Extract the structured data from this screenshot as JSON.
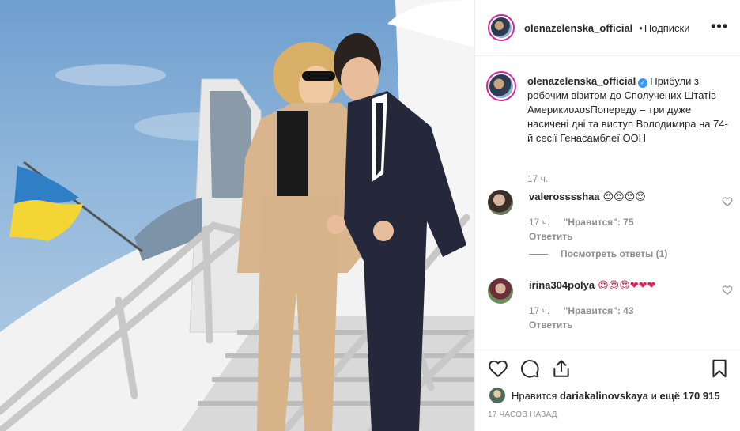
{
  "post": {
    "username": "olenazelenska_official",
    "dot": "•",
    "follow_label": "Подписки",
    "more_label": "•••"
  },
  "caption": {
    "username": "olenazelenska_official",
    "text": "Прибули з робочим візитом до Сполучених Штатів АмерикиᴜᴀᴜѕПопереду – три дуже насичені дні та виступ Володимира на 74-й сесії Генасамблеї ООН",
    "time": "17 ч."
  },
  "comments": [
    {
      "username": "valerossss haa",
      "username_exact": "valerosssshaa",
      "text": "😍😍😍😍",
      "time": "17 ч.",
      "likes": "\"Нравится\": 75",
      "reply": "Ответить",
      "view_replies": "Посмотреть ответы (1)"
    },
    {
      "username_exact": "irina304polya",
      "text": "😍😍😍❤❤❤",
      "time": "17 ч.",
      "likes": "\"Нравится\": 43",
      "reply": "Ответить"
    }
  ],
  "likes": {
    "prefix": "Нравится",
    "user": "dariakalinovskaya",
    "middle": "и",
    "count": "ещё 170 915"
  },
  "timestamp": "17 ЧАСОВ НАЗАД",
  "icons": {
    "like": "heart-icon",
    "comment": "comment-icon",
    "share": "share-icon",
    "save": "bookmark-icon"
  },
  "colors": {
    "accent": "#3897f0",
    "muted": "#8e8e8e",
    "text": "#262626",
    "flag_blue": "#2f7fc6",
    "flag_yellow": "#f3d533"
  }
}
